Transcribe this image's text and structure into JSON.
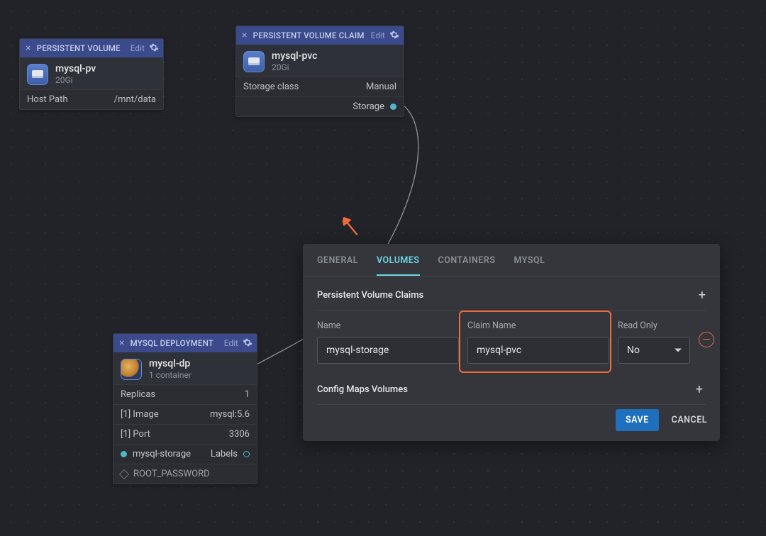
{
  "nodes": {
    "pv": {
      "header": "PERSISTENT VOLUME",
      "edit": "Edit",
      "name": "mysql-pv",
      "size": "20Gi",
      "row_key": "Host Path",
      "row_val": "/mnt/data"
    },
    "pvc": {
      "header": "PERSISTENT VOLUME CLAIM",
      "edit": "Edit",
      "name": "mysql-pvc",
      "size": "20Gi",
      "row_key": "Storage class",
      "row_val": "Manual",
      "foot": "Storage"
    },
    "dep": {
      "header": "MYSQL DEPLOYMENT",
      "edit": "Edit",
      "name": "mysql-dp",
      "sub": "1 container",
      "rows": [
        {
          "k": "Replicas",
          "v": "1"
        },
        {
          "k": "[1] Image",
          "v": "mysql:5.6"
        },
        {
          "k": "[1] Port",
          "v": "3306"
        }
      ],
      "foot_left": "mysql-storage",
      "foot_right": "Labels",
      "rootpwd": "ROOT_PASSWORD"
    }
  },
  "panel": {
    "tabs": {
      "general": "GENERAL",
      "volumes": "VOLUMES",
      "containers": "CONTAINERS",
      "mysql": "MYSQL"
    },
    "pvc_section_title": "Persistent Volume Claims",
    "labels": {
      "name": "Name",
      "claim": "Claim Name",
      "readonly": "Read Only"
    },
    "values": {
      "name": "mysql-storage",
      "claim": "mysql-pvc",
      "readonly": "No"
    },
    "cfg_section_title": "Config Maps Volumes",
    "save": "SAVE",
    "cancel": "CANCEL"
  }
}
